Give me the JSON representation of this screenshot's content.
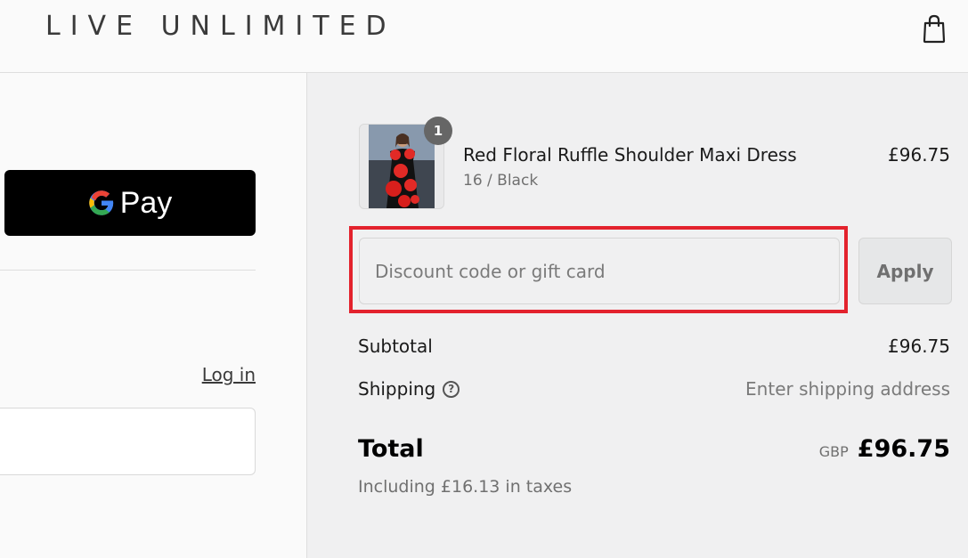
{
  "header": {
    "brand": "LIVE UNLIMITED",
    "cart_icon": "shopping-bag-icon"
  },
  "express_checkout": {
    "gpay_label": "Pay",
    "gpay_icon": "google-g-icon"
  },
  "contact": {
    "login_label": "Log in"
  },
  "order_summary": {
    "item": {
      "name": "Red Floral Ruffle Shoulder Maxi Dress",
      "variant": "16 / Black",
      "price": "£96.75",
      "quantity": "1"
    },
    "discount": {
      "placeholder": "Discount code or gift card",
      "value": "",
      "apply_label": "Apply"
    },
    "subtotal": {
      "label": "Subtotal",
      "value": "£96.75"
    },
    "shipping": {
      "label": "Shipping",
      "help_icon": "question-circle-icon",
      "value": "Enter shipping address"
    },
    "total": {
      "label": "Total",
      "currency": "GBP",
      "value": "£96.75",
      "taxes_note": "Including £16.13 in taxes"
    }
  },
  "colors": {
    "highlight": "#e3222d",
    "summary_bg": "#f0f0f1",
    "gpay_bg": "#000000"
  }
}
